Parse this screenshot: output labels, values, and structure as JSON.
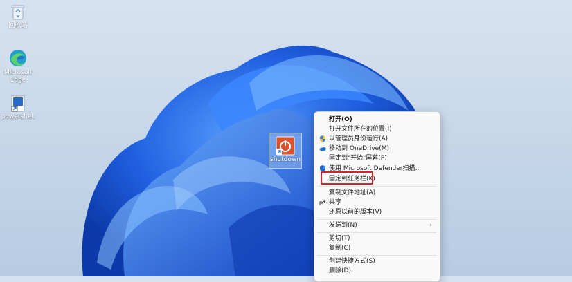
{
  "desktop": {
    "icons": [
      {
        "label": "回收站",
        "icon": "recycle-bin-icon"
      },
      {
        "label": "Microsoft Edge",
        "icon": "edge-icon"
      },
      {
        "label": "powershell",
        "icon": "powershell-shortcut-icon"
      }
    ],
    "selected_shortcut": {
      "label": "shutdown",
      "icon": "power-icon"
    }
  },
  "context_menu": {
    "items": [
      {
        "label": "打开(O)",
        "bold": true,
        "icon": ""
      },
      {
        "label": "打开文件所在的位置(I)",
        "icon": ""
      },
      {
        "label": "以管理员身份运行(A)",
        "icon": "shield-icon"
      },
      {
        "label": "移动到 OneDrive(M)",
        "icon": "onedrive-icon"
      },
      {
        "label": "固定到\"开始\"屏幕(P)",
        "icon": ""
      },
      {
        "label": "使用 Microsoft Defender扫描...",
        "icon": "defender-icon"
      },
      {
        "label": "固定到任务栏(K)",
        "icon": "",
        "highlighted": true
      },
      {
        "label": "复制文件地址(A)",
        "icon": ""
      },
      {
        "label": "共享",
        "icon": "share-icon"
      },
      {
        "label": "还原以前的版本(V)",
        "icon": ""
      },
      {
        "label": "发送到(N)",
        "icon": "",
        "submenu": true
      },
      {
        "label": "剪切(T)",
        "icon": ""
      },
      {
        "label": "复制(C)",
        "icon": ""
      },
      {
        "label": "创建快捷方式(S)",
        "icon": ""
      },
      {
        "label": "删除(D)",
        "icon": ""
      }
    ],
    "submenu_arrow": "›"
  },
  "colors": {
    "highlight_border": "#d4232a",
    "menu_bg": "#f9f9f9",
    "bloom_blue": "#1f5fe0"
  }
}
